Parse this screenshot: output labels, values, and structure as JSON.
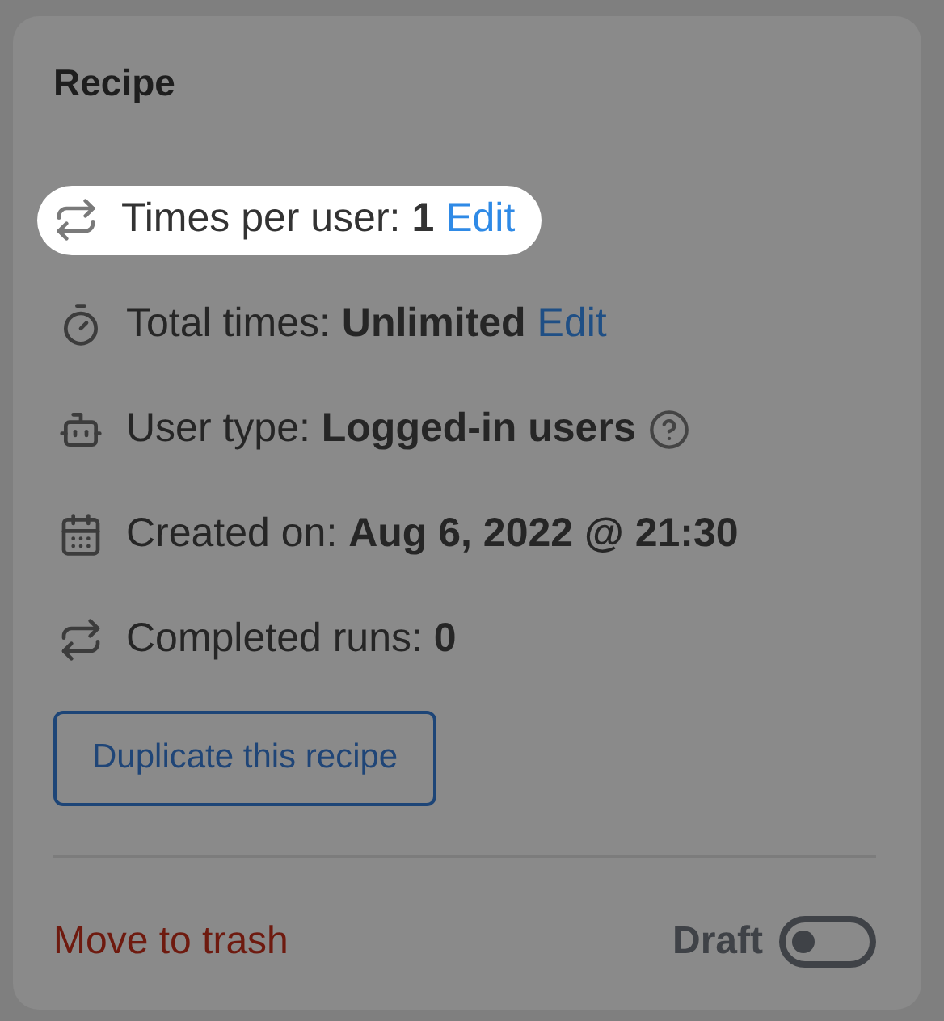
{
  "card": {
    "title": "Recipe"
  },
  "rows": [
    {
      "label": "Times per user:",
      "value": "1",
      "link": "Edit",
      "help": false,
      "highlighted": true
    },
    {
      "label": "Total times:",
      "value": "Unlimited",
      "link": "Edit",
      "help": false,
      "highlighted": false
    },
    {
      "label": "User type:",
      "value": "Logged-in users",
      "help": true,
      "highlighted": false
    },
    {
      "label": "Created on:",
      "value": "Aug 6, 2022 @ 21:30",
      "help": false,
      "highlighted": false
    },
    {
      "label": "Completed runs:",
      "value": "0",
      "help": false,
      "highlighted": false
    }
  ],
  "duplicate_button": "Duplicate this recipe",
  "trash_link": "Move to trash",
  "status": {
    "label": "Draft",
    "on": false
  }
}
